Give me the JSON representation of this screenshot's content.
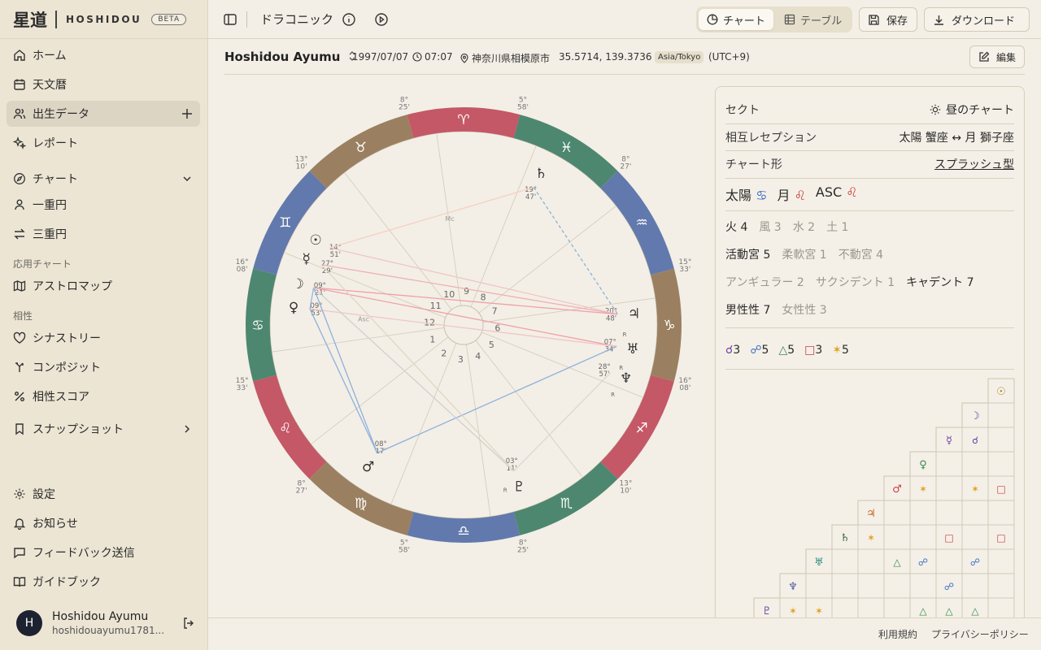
{
  "brand": {
    "kanji": "星道",
    "name": "HOSHIDOU",
    "badge": "BETA"
  },
  "sidebar": {
    "items": [
      {
        "label": "ホーム",
        "icon": "home-icon"
      },
      {
        "label": "天文暦",
        "icon": "calendar-icon"
      },
      {
        "label": "出生データ",
        "icon": "users-icon",
        "active": true
      },
      {
        "label": "レポート",
        "icon": "sparkles-icon"
      },
      {
        "label": "チャート",
        "icon": "compass-icon"
      },
      {
        "label": "一重円",
        "icon": "user-icon"
      },
      {
        "label": "三重円",
        "icon": "arrows-icon"
      },
      {
        "label": "アストロマップ",
        "icon": "map-icon"
      },
      {
        "label": "シナストリー",
        "icon": "heart-icon"
      },
      {
        "label": "コンポジット",
        "icon": "merge-icon"
      },
      {
        "label": "相性スコア",
        "icon": "percent-icon"
      },
      {
        "label": "スナップショット",
        "icon": "bookmark-icon"
      },
      {
        "label": "設定",
        "icon": "gear-icon"
      },
      {
        "label": "お知らせ",
        "icon": "bell-icon"
      },
      {
        "label": "フィードバック送信",
        "icon": "message-icon"
      },
      {
        "label": "ガイドブック",
        "icon": "book-icon"
      }
    ],
    "sections": {
      "applied": "応用チャート",
      "compat": "相性"
    },
    "user": {
      "initial": "H",
      "name": "Hoshidou Ayumu",
      "email": "hoshidouayumu1781..."
    }
  },
  "header": {
    "title": "ドラコニック",
    "tabs": [
      "チャート",
      "テーブル"
    ],
    "active_tab": "チャート",
    "save_label": "保存",
    "download_label": "ダウンロード"
  },
  "subject": {
    "name": "Hoshidou Ayumu",
    "date": "1997/07/07",
    "time": "07:07",
    "place": "神奈川県相模原市",
    "coords": "35.5714, 139.3736",
    "tz": "Asia/Tokyo",
    "offset": "(UTC+9)",
    "edit_label": "編集"
  },
  "panel": {
    "sect_label": "セクト",
    "sect_value": "昼のチャート",
    "reception_label": "相互レセプション",
    "reception_value": "太陽 蟹座 ↔ 月 獅子座",
    "shape_label": "チャート形",
    "shape_value": "スプラッシュ型",
    "big3": {
      "sun": "太陽",
      "sun_sign": "♋",
      "moon": "月",
      "moon_sign": "♌",
      "asc": "ASC",
      "asc_sign": "♌"
    },
    "elements": [
      {
        "label": "火 4",
        "on": true
      },
      {
        "label": "風 3",
        "on": false
      },
      {
        "label": "水 2",
        "on": false
      },
      {
        "label": "土 1",
        "on": false
      }
    ],
    "modalities": [
      {
        "label": "活動宮 5",
        "on": true
      },
      {
        "label": "柔軟宮 1",
        "on": false
      },
      {
        "label": "不動宮 4",
        "on": false
      }
    ],
    "houses": [
      {
        "label": "アンギュラー 2",
        "on": false
      },
      {
        "label": "サクシデント 1",
        "on": false
      },
      {
        "label": "キャデント 7",
        "on": true
      }
    ],
    "polarity": [
      {
        "label": "男性性 7",
        "on": true
      },
      {
        "label": "女性性 3",
        "on": false
      }
    ],
    "aspects": [
      {
        "glyph": "☌",
        "count": "3",
        "color": "#6a3fa0"
      },
      {
        "glyph": "☍",
        "count": "5",
        "color": "#3d6fc4"
      },
      {
        "glyph": "△",
        "count": "5",
        "color": "#3a8a4a"
      },
      {
        "glyph": "□",
        "count": "3",
        "color": "#c94040"
      },
      {
        "glyph": "✶",
        "count": "5",
        "color": "#e0a020"
      }
    ]
  },
  "wheel": {
    "signs": [
      "♈",
      "♉",
      "♊",
      "♋",
      "♌",
      "♍",
      "♎",
      "♏",
      "♐",
      "♑",
      "♒",
      "♓"
    ],
    "house_numbers": [
      "1",
      "2",
      "3",
      "4",
      "5",
      "6",
      "7",
      "8",
      "9",
      "10",
      "11",
      "12"
    ],
    "cusp_degrees": [
      {
        "deg": "8°",
        "min": "25'"
      },
      {
        "deg": "5°",
        "min": "58'"
      },
      {
        "deg": "8°",
        "min": "27'"
      },
      {
        "deg": "15°",
        "min": "33'"
      },
      {
        "deg": "16°",
        "min": "08'"
      },
      {
        "deg": "13°",
        "min": "10'"
      },
      {
        "deg": "8°",
        "min": "25'"
      },
      {
        "deg": "5°",
        "min": "58'"
      },
      {
        "deg": "8°",
        "min": "27'"
      },
      {
        "deg": "15°",
        "min": "33'"
      },
      {
        "deg": "16°",
        "min": "08'"
      },
      {
        "deg": "13°",
        "min": "10'"
      }
    ],
    "planets": [
      {
        "glyph": "☉",
        "deg": "14°",
        "min": "51'",
        "color": "#333"
      },
      {
        "glyph": "☿",
        "deg": "27°",
        "min": "29'",
        "color": "#333"
      },
      {
        "glyph": "☽",
        "deg": "09°",
        "min": "21'",
        "color": "#333"
      },
      {
        "glyph": "♀",
        "deg": "09°",
        "min": "53'",
        "color": "#333"
      },
      {
        "glyph": "♂",
        "deg": "08°",
        "min": "17'",
        "color": "#333"
      },
      {
        "glyph": "♃",
        "deg": "20°",
        "min": "48'",
        "color": "#333",
        "r": "R"
      },
      {
        "glyph": "♄",
        "deg": "19°",
        "min": "47'",
        "color": "#333"
      },
      {
        "glyph": "♅",
        "deg": "07°",
        "min": "34'",
        "color": "#333",
        "r": "R"
      },
      {
        "glyph": "♆",
        "deg": "28°",
        "min": "57'",
        "color": "#333",
        "r": "R"
      },
      {
        "glyph": "♇",
        "deg": "03°",
        "min": "11'",
        "color": "#333",
        "r": "R"
      }
    ],
    "mc_label": "Mc",
    "asc_label": "Asc"
  },
  "aspect_grid": {
    "planets": [
      "☉",
      "☽",
      "☿",
      "♀",
      "♂",
      "♃",
      "♄",
      "♅",
      "♆",
      "♇"
    ],
    "cells": [
      {
        "r": 2,
        "c": 1,
        "g": "☌",
        "color": "#6a3fa0"
      },
      {
        "r": 4,
        "c": 0,
        "g": "□",
        "color": "#c94040"
      },
      {
        "r": 4,
        "c": 1,
        "g": "✶",
        "color": "#e0a020"
      },
      {
        "r": 4,
        "c": 3,
        "g": "✶",
        "color": "#e0a020"
      },
      {
        "r": 6,
        "c": 0,
        "g": "□",
        "color": "#c94040"
      },
      {
        "r": 6,
        "c": 2,
        "g": "□",
        "color": "#c94040"
      },
      {
        "r": 6,
        "c": 5,
        "g": "✶",
        "color": "#e0a020"
      },
      {
        "r": 7,
        "c": 1,
        "g": "☍",
        "color": "#3d6fc4"
      },
      {
        "r": 7,
        "c": 3,
        "g": "☍",
        "color": "#3d6fc4"
      },
      {
        "r": 7,
        "c": 4,
        "g": "△",
        "color": "#3a8a4a"
      },
      {
        "r": 8,
        "c": 2,
        "g": "☍",
        "color": "#3d6fc4"
      },
      {
        "r": 9,
        "c": 1,
        "g": "△",
        "color": "#3a8a4a"
      },
      {
        "r": 9,
        "c": 2,
        "g": "△",
        "color": "#3a8a4a"
      },
      {
        "r": 9,
        "c": 3,
        "g": "△",
        "color": "#3a8a4a"
      },
      {
        "r": 9,
        "c": 7,
        "g": "✶",
        "color": "#e0a020"
      },
      {
        "r": 9,
        "c": 8,
        "g": "✶",
        "color": "#e0a020"
      }
    ]
  },
  "footer": {
    "terms": "利用規約",
    "privacy": "プライバシーポリシー"
  },
  "colors": {
    "fire": "#c45866",
    "earth": "#9a8060",
    "air": "#6279ad",
    "water": "#4d8770"
  }
}
